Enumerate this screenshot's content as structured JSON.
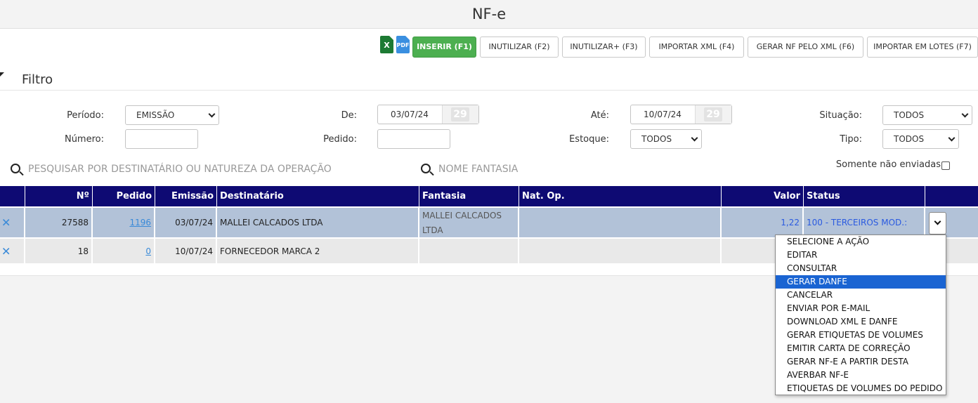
{
  "page": {
    "title": "NF-e"
  },
  "toolbar": {
    "excel_icon_text": "X",
    "pdf_icon_text": "PDF",
    "buttons": [
      "INSERIR (F1)",
      "INUTILIZAR (F2)",
      "INUTILIZAR+ (F3)",
      "IMPORTAR XML (F4)",
      "GERAR NF PELO XML (F6)",
      "IMPORTAR EM LOTES (F7)"
    ]
  },
  "filter": {
    "title": "Filtro",
    "periodo_label": "Período:",
    "periodo_value": "EMISSÃO",
    "de_label": "De:",
    "de_value": "03/07/24",
    "ate_label": "Até:",
    "ate_value": "10/07/24",
    "calendar_day": "29",
    "situacao_label": "Situação:",
    "situacao_value": "TODOS",
    "numero_label": "Número:",
    "numero_value": "",
    "pedido_label": "Pedido:",
    "pedido_value": "",
    "estoque_label": "Estoque:",
    "estoque_value": "TODOS",
    "tipo_label": "Tipo:",
    "tipo_value": "TODOS"
  },
  "search": {
    "main_placeholder": "PESQUISAR POR DESTINATÁRIO OU NATUREZA DA OPERAÇÃO",
    "fantasia_placeholder": "NOME FANTASIA",
    "somente_label": "Somente não enviadas",
    "somente_checked": false
  },
  "table": {
    "headers": [
      "Nº",
      "Pedido",
      "Emissão",
      "Destinatário",
      "Fantasia",
      "Nat. Op.",
      "Valor",
      "Status"
    ],
    "rows": [
      {
        "delete": "✕",
        "numero": "27588",
        "pedido": "1196",
        "emissao": "03/07/24",
        "destinatario": "MALLEI CALCADOS LTDA",
        "fantasia_l1": "MALLEI CALCADOS",
        "fantasia_l2": "LTDA",
        "nat_op": "",
        "valor": "1,22",
        "status": "100 - TERCEIROS MOD.:"
      },
      {
        "delete": "✕",
        "numero": "18",
        "pedido": "0",
        "emissao": "10/07/24",
        "destinatario": "FORNECEDOR MARCA 2",
        "fantasia_l1": "",
        "fantasia_l2": "",
        "nat_op": "",
        "valor": "",
        "status": ""
      }
    ]
  },
  "actions_menu": {
    "selected_index": 3,
    "items": [
      "SELECIONE A AÇÃO",
      "EDITAR",
      "CONSULTAR",
      "GERAR DANFE",
      "CANCELAR",
      "ENVIAR POR E-MAIL",
      "DOWNLOAD XML E DANFE",
      "GERAR ETIQUETAS DE VOLUMES",
      "EMITIR CARTA DE CORREÇÃO",
      "GERAR NF-E A PARTIR DESTA",
      "AVERBAR NF-E",
      "ETIQUETAS DE VOLUMES DO PEDIDO"
    ]
  },
  "colors": {
    "table_header": "#0e0a73",
    "primary_button": "#4caf50",
    "selected_row": "#b2c2d8",
    "link": "#3a8ad8",
    "status_text": "#2a5ae0",
    "menu_highlight": "#1a64d2"
  }
}
